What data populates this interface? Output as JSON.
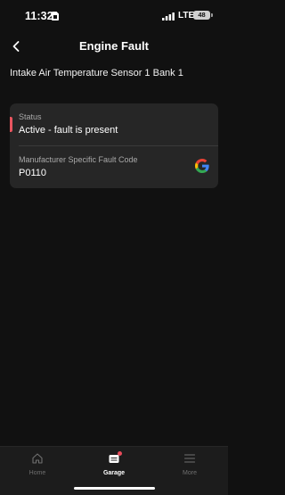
{
  "status_bar": {
    "time": "11:32",
    "carrier": "LTE",
    "battery_level": "48"
  },
  "header": {
    "title": "Engine Fault"
  },
  "fault": {
    "name": "Intake Air Temperature Sensor 1 Bank 1",
    "status_label": "Status",
    "status_value": "Active - fault is present",
    "status_color": "#e9555f",
    "code_label": "Manufacturer Specific Fault Code",
    "code_value": "P0110",
    "search_icon": "google-icon"
  },
  "tab_bar": {
    "tabs": [
      {
        "label": "Home",
        "icon": "home-icon",
        "active": false
      },
      {
        "label": "Garage",
        "icon": "garage-icon",
        "active": true,
        "badge": true
      },
      {
        "label": "More",
        "icon": "menu-icon",
        "active": false
      }
    ],
    "badge_color": "#e84b5a"
  }
}
